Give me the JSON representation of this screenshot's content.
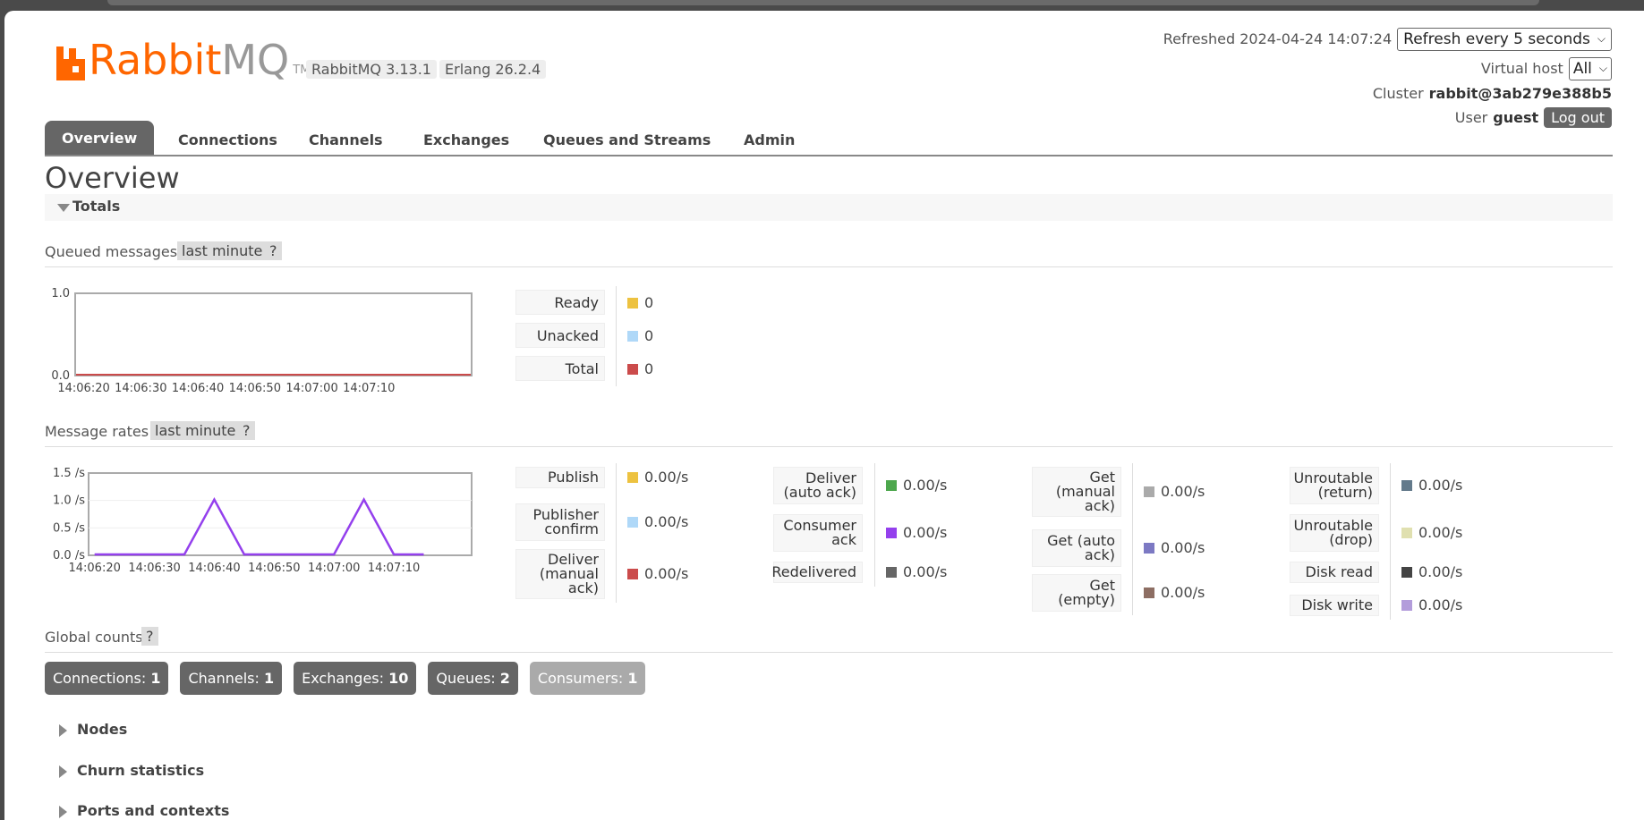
{
  "header": {
    "logo_text_orange": "Rabbit",
    "logo_text_grey": "MQ",
    "logo_tm": "TM",
    "version_rabbit": "RabbitMQ 3.13.1",
    "version_erlang": "Erlang 26.2.4",
    "refreshed_label": "Refreshed 2024-04-24 14:07:24",
    "refresh_select": "Refresh every 5 seconds",
    "vhost_label": "Virtual host",
    "vhost_value": "All",
    "cluster_label": "Cluster",
    "cluster_value": "rabbit@3ab279e388b5",
    "user_label": "User",
    "user_value": "guest",
    "logout_label": "Log out"
  },
  "tabs": [
    {
      "label": "Overview",
      "active": true
    },
    {
      "label": "Connections"
    },
    {
      "label": "Channels"
    },
    {
      "label": "Exchanges"
    },
    {
      "label": "Queues and Streams"
    },
    {
      "label": "Admin"
    }
  ],
  "page_title": "Overview",
  "totals_label": "Totals",
  "queued": {
    "title": "Queued messages",
    "range_badge": "last minute",
    "help": "?",
    "legend": [
      {
        "label": "Ready",
        "value": "0",
        "color": "#edc240"
      },
      {
        "label": "Unacked",
        "value": "0",
        "color": "#afd8f8"
      },
      {
        "label": "Total",
        "value": "0",
        "color": "#cb4b4b"
      }
    ]
  },
  "rates": {
    "title": "Message rates",
    "range_badge": "last minute",
    "help": "?",
    "legend_cols": [
      [
        {
          "label": "Publish",
          "value": "0.00/s",
          "color": "#edc240"
        },
        {
          "label": "Publisher confirm",
          "value": "0.00/s",
          "color": "#afd8f8"
        },
        {
          "label": "Deliver (manual ack)",
          "value": "0.00/s",
          "color": "#cb4b4b"
        }
      ],
      [
        {
          "label": "Deliver (auto ack)",
          "value": "0.00/s",
          "color": "#4da74d"
        },
        {
          "label": "Consumer ack",
          "value": "0.00/s",
          "color": "#9440ed"
        },
        {
          "label": "Redelivered",
          "value": "0.00/s",
          "color": "#666666"
        }
      ],
      [
        {
          "label": "Get (manual ack)",
          "value": "0.00/s",
          "color": "#aaaaaa"
        },
        {
          "label": "Get (auto ack)",
          "value": "0.00/s",
          "color": "#7c79c3"
        },
        {
          "label": "Get (empty)",
          "value": "0.00/s",
          "color": "#8d6e63"
        }
      ],
      [
        {
          "label": "Unroutable (return)",
          "value": "0.00/s",
          "color": "#637a8b"
        },
        {
          "label": "Unroutable (drop)",
          "value": "0.00/s",
          "color": "#e0e0b0"
        },
        {
          "label": "Disk read",
          "value": "0.00/s",
          "color": "#444444"
        },
        {
          "label": "Disk write",
          "value": "0.00/s",
          "color": "#b39ddb"
        }
      ]
    ]
  },
  "global_counts": {
    "title": "Global counts",
    "help": "?",
    "items": [
      {
        "label": "Connections:",
        "value": "1"
      },
      {
        "label": "Channels:",
        "value": "1"
      },
      {
        "label": "Exchanges:",
        "value": "10"
      },
      {
        "label": "Queues:",
        "value": "2"
      },
      {
        "label": "Consumers:",
        "value": "1",
        "dimmed": true
      }
    ]
  },
  "collapsed_sections": [
    "Nodes",
    "Churn statistics",
    "Ports and contexts"
  ],
  "chart_data": [
    {
      "type": "line",
      "title": "Queued messages",
      "x": [
        "14:06:20",
        "14:06:30",
        "14:06:40",
        "14:06:50",
        "14:07:00",
        "14:07:10"
      ],
      "ylim": [
        0,
        1.0
      ],
      "yticks": [
        "0.0",
        "1.0"
      ],
      "series": [
        {
          "name": "Total",
          "color": "#cb4b4b",
          "values": [
            0,
            0,
            0,
            0,
            0,
            0
          ]
        }
      ]
    },
    {
      "type": "line",
      "title": "Message rates",
      "x": [
        "14:06:20",
        "14:06:30",
        "14:06:40",
        "14:06:50",
        "14:07:00",
        "14:07:10"
      ],
      "ylim": [
        0,
        1.5
      ],
      "yticks": [
        "0.0 /s",
        "0.5 /s",
        "1.0 /s",
        "1.5 /s"
      ],
      "series": [
        {
          "name": "Consumer ack",
          "color": "#9440ed",
          "points": [
            [
              "14:06:20",
              0
            ],
            [
              "14:06:35",
              0
            ],
            [
              "14:06:40",
              1.0
            ],
            [
              "14:06:45",
              0
            ],
            [
              "14:07:00",
              0
            ],
            [
              "14:07:05",
              1.0
            ],
            [
              "14:07:10",
              0
            ],
            [
              "14:07:15",
              0
            ]
          ]
        }
      ]
    }
  ]
}
